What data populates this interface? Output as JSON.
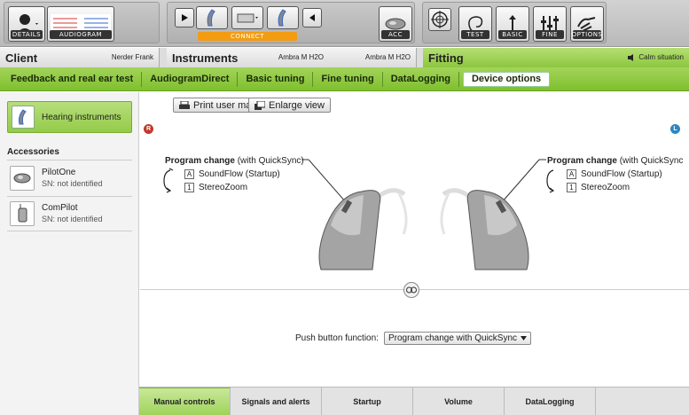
{
  "toolbar": {
    "details_label": "DETAILS",
    "audiogram_label": "AUDIOGRAM",
    "connect_label": "CONNECT",
    "acc_label": "ACC",
    "test_label": "TEST",
    "basic_label": "BASIC",
    "fine_label": "FINE",
    "options_label": "OPTIONS"
  },
  "tabs": {
    "client": {
      "title": "Client",
      "value": "Nerder Frank"
    },
    "instruments": {
      "title": "Instruments",
      "left_model": "Ambra M H2O",
      "right_model": "Ambra M H2O"
    },
    "fitting": {
      "title": "Fitting",
      "situation": "Calm situation"
    }
  },
  "subnav": {
    "items": [
      "Feedback and real ear test",
      "AudiogramDirect",
      "Basic tuning",
      "Fine tuning",
      "DataLogging",
      "Device options"
    ],
    "active": "Device options"
  },
  "left": {
    "hearing_instruments": "Hearing instruments",
    "accessories_title": "Accessories",
    "accessories": [
      {
        "name": "PilotOne",
        "sn": "SN: not identified"
      },
      {
        "name": "ComPilot",
        "sn": "SN: not identified"
      }
    ]
  },
  "main": {
    "print_label": "Print user manual",
    "enlarge_label": "Enlarge view",
    "badge_right": "R",
    "badge_left": "L",
    "right_side": {
      "title_bold": "Program change",
      "title_rest": " (with QuickSync)",
      "programs": [
        {
          "key": "A",
          "label": "SoundFlow (Startup)"
        },
        {
          "key": "1",
          "label": "StereoZoom"
        }
      ]
    },
    "left_side": {
      "title_bold": "Program change",
      "title_rest": " (with QuickSync",
      "programs": [
        {
          "key": "A",
          "label": "SoundFlow (Startup)"
        },
        {
          "key": "1",
          "label": "StereoZoom"
        }
      ]
    },
    "push_label": "Push button function:",
    "push_value": "Program change with QuickSync"
  },
  "bottom_tabs": {
    "items": [
      "Manual controls",
      "Signals and alerts",
      "Startup",
      "Volume",
      "DataLogging"
    ],
    "active": "Manual controls"
  },
  "colors": {
    "accent_green": "#8cc63f",
    "badge_red": "#c0392b",
    "badge_blue": "#2e86c1"
  }
}
